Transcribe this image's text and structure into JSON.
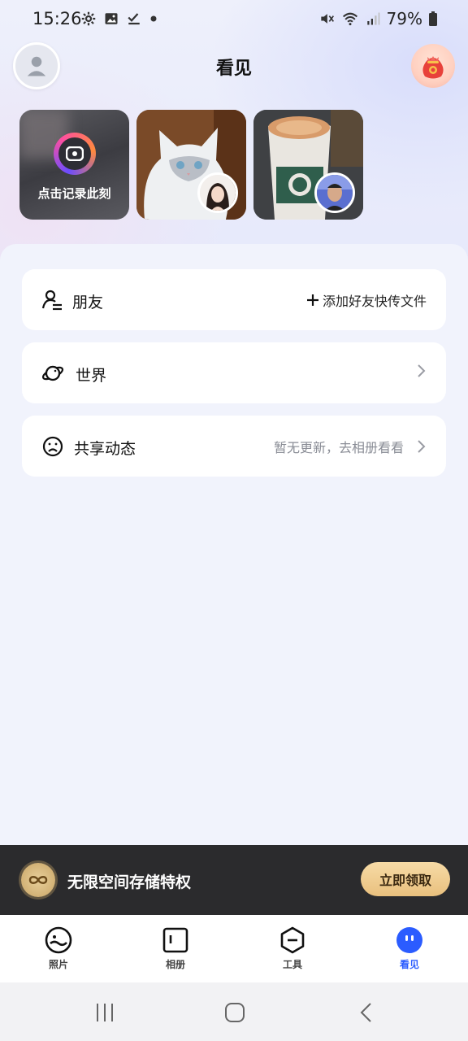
{
  "status_bar": {
    "time": "15:26",
    "battery": "79%"
  },
  "header": {
    "title": "看见"
  },
  "moments": {
    "record_label": "点击记录此刻"
  },
  "rows": {
    "friends": {
      "label": "朋友",
      "action": "添加好友快传文件"
    },
    "world": {
      "label": "世界"
    },
    "shared": {
      "label": "共享动态",
      "hint": "暂无更新，去相册看看"
    }
  },
  "banner": {
    "text": "无限空间存储特权",
    "button": "立即领取"
  },
  "bottom_nav": {
    "items": [
      {
        "label": "照片",
        "icon": "photos-smile-icon"
      },
      {
        "label": "相册",
        "icon": "album-icon"
      },
      {
        "label": "工具",
        "icon": "tools-icon"
      },
      {
        "label": "看见",
        "icon": "discover-icon",
        "active": true
      }
    ]
  },
  "colors": {
    "accent": "#2b5cff",
    "banner_bg": "#2b2b2d",
    "gold": "#e9c07e"
  }
}
